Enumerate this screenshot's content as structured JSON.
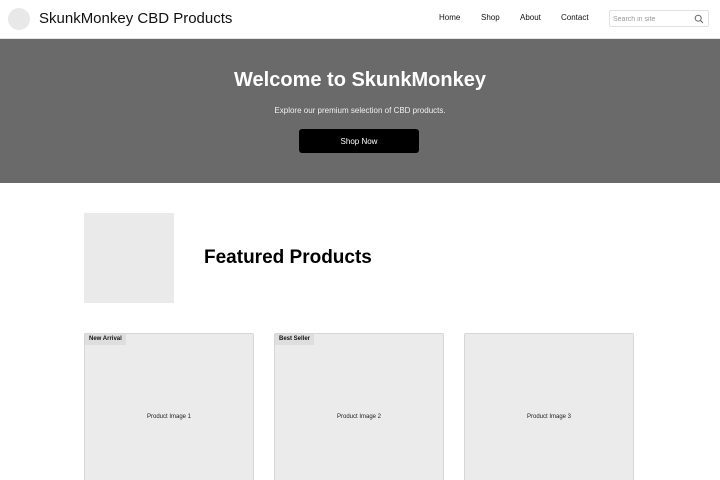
{
  "header": {
    "brand": "SkunkMonkey CBD Products",
    "nav": {
      "home": "Home",
      "shop": "Shop",
      "about": "About",
      "contact": "Contact"
    },
    "search": {
      "placeholder": "Search in site",
      "icon": "search-icon"
    }
  },
  "hero": {
    "title": "Welcome to SkunkMonkey",
    "subtitle": "Explore our premium selection of CBD products.",
    "cta_label": "Shop Now"
  },
  "featured": {
    "title": "Featured Products"
  },
  "products": [
    {
      "badge": "New Arrival",
      "image_label": "Product Image 1"
    },
    {
      "badge": "Best Seller",
      "image_label": "Product Image 2"
    },
    {
      "badge": "",
      "image_label": "Product Image 3"
    }
  ],
  "colors": {
    "hero_bg": "#6a6a6a",
    "cta_bg": "#000000",
    "placeholder_bg": "#ebebeb"
  }
}
